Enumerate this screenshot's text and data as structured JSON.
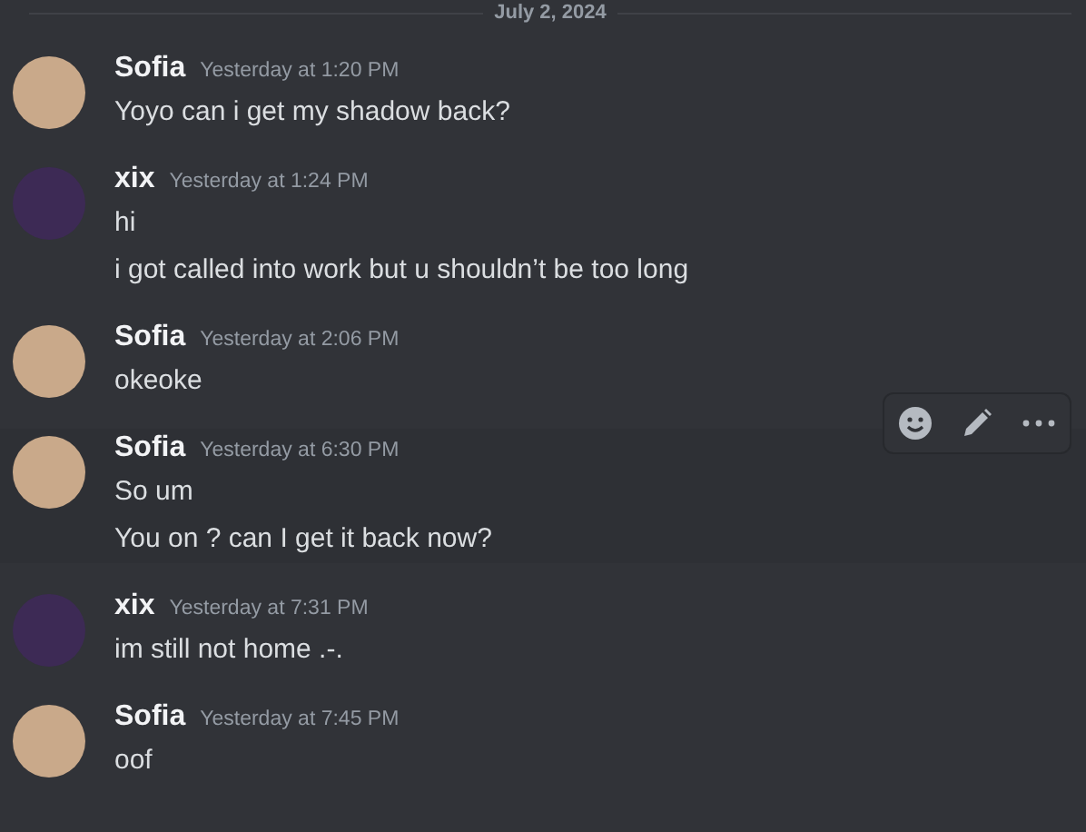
{
  "date_divider": "July 2, 2024",
  "message_groups": [
    {
      "author": "Sofia",
      "color": "#c9a98a",
      "timestamp": "Yesterday at 1:20 PM",
      "hovered": false,
      "messages": [
        "Yoyo can i get my shadow back?"
      ]
    },
    {
      "author": "xix",
      "color": "#3d2a55",
      "timestamp": "Yesterday at 1:24 PM",
      "hovered": false,
      "messages": [
        "hi",
        "i got called into work but u shouldn’t be too long"
      ]
    },
    {
      "author": "Sofia",
      "color": "#c9a98a",
      "timestamp": "Yesterday at 2:06 PM",
      "hovered": false,
      "messages": [
        "okeoke"
      ]
    },
    {
      "author": "Sofia",
      "color": "#c9a98a",
      "timestamp": "Yesterday at 6:30 PM",
      "hovered": true,
      "messages": [
        "So um",
        "You on ? can I get it back now?"
      ]
    },
    {
      "author": "xix",
      "color": "#3d2a55",
      "timestamp": "Yesterday at 7:31 PM",
      "hovered": false,
      "messages": [
        "im still not home .-."
      ]
    },
    {
      "author": "Sofia",
      "color": "#c9a98a",
      "timestamp": "Yesterday at 7:45 PM",
      "hovered": false,
      "messages": [
        "oof"
      ]
    }
  ]
}
